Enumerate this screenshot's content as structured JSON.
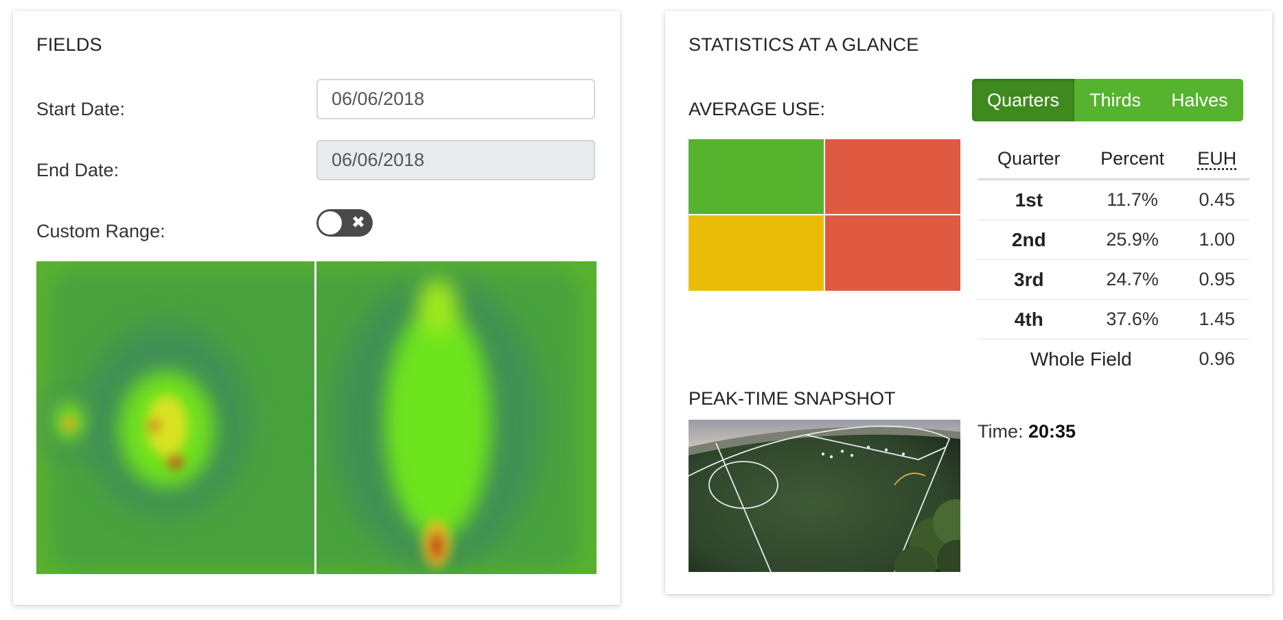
{
  "fields_card": {
    "title": "FIELDS",
    "start_date_label": "Start Date:",
    "start_date_value": "06/06/2018",
    "end_date_label": "End Date:",
    "end_date_value": "06/06/2018",
    "custom_range_label": "Custom Range:",
    "custom_range_enabled": false,
    "toggle_icon": "close-icon"
  },
  "stats_card": {
    "title": "STATISTICS AT A GLANCE",
    "average_use_label": "AVERAGE USE:",
    "segments": [
      {
        "label": "Quarters",
        "active": true
      },
      {
        "label": "Thirds",
        "active": false
      },
      {
        "label": "Halves",
        "active": false
      }
    ],
    "quarter_colors": [
      "#55b32e",
      "#e05a42",
      "#e9bd07",
      "#e05a42"
    ],
    "table": {
      "headers": [
        "Quarter",
        "Percent",
        "EUH"
      ],
      "rows": [
        {
          "quarter": "1st",
          "percent": "11.7%",
          "euh": "0.45"
        },
        {
          "quarter": "2nd",
          "percent": "25.9%",
          "euh": "1.00"
        },
        {
          "quarter": "3rd",
          "percent": "24.7%",
          "euh": "0.95"
        },
        {
          "quarter": "4th",
          "percent": "37.6%",
          "euh": "1.45"
        }
      ],
      "whole_field_label": "Whole Field",
      "whole_field_euh": "0.96"
    },
    "snapshot_title": "PEAK-TIME SNAPSHOT",
    "time_label": "Time:",
    "time_value": "20:35"
  },
  "colors": {
    "field_green": "#58b12f",
    "button_green": "#55b32e",
    "button_green_active": "#3e8a1f"
  }
}
